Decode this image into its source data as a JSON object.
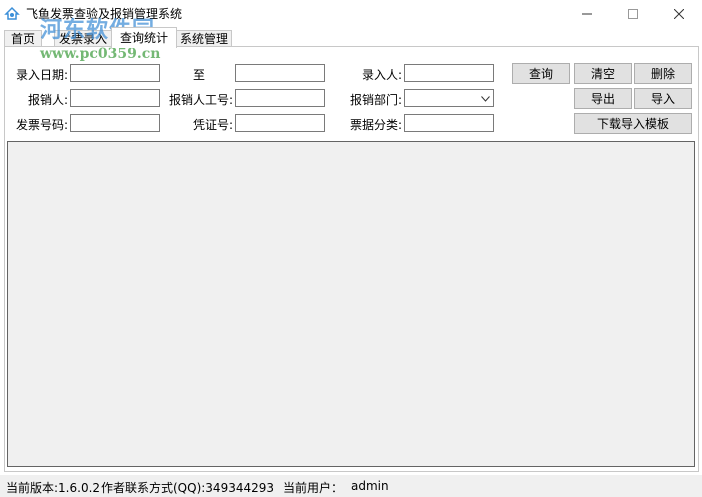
{
  "window": {
    "title": "飞鱼发票查验及报销管理系统",
    "controls": {
      "minimize": "—",
      "maximize": "☐",
      "close": "✕"
    }
  },
  "watermark": {
    "text": "河东软件园",
    "url": "www.pc0359.cn"
  },
  "tabs": [
    {
      "label": "首页",
      "active": false
    },
    {
      "label": "发票录入",
      "active": false
    },
    {
      "label": "查询统计",
      "active": true
    },
    {
      "label": "系统管理",
      "active": false
    }
  ],
  "filters": {
    "entry_date_label": "录入日期:",
    "to_label": "至",
    "entry_person_label": "录入人:",
    "reimburser_label": "报销人:",
    "reimburser_id_label": "报销人工号:",
    "department_label": "报销部门:",
    "invoice_no_label": "发票号码:",
    "voucher_no_label": "凭证号:",
    "category_label": "票据分类:",
    "entry_date_from": "",
    "entry_date_to": "",
    "entry_person": "",
    "reimburser": "",
    "reimburser_id": "",
    "department_selected": "",
    "invoice_no": "",
    "voucher_no": "",
    "category": ""
  },
  "buttons": {
    "query": "查询",
    "clear": "清空",
    "delete": "删除",
    "export": "导出",
    "import": "导入",
    "download_template": "下载导入模板"
  },
  "status": {
    "version": "当前版本:1.6.0.2",
    "contact": "作者联系方式(QQ):349344293",
    "user_label": "当前用户：",
    "user": "admin"
  },
  "colors": {
    "accent": "#3c8fd8",
    "grid_background": "#f0f0f0",
    "statusbar": "#f0f0f0"
  }
}
